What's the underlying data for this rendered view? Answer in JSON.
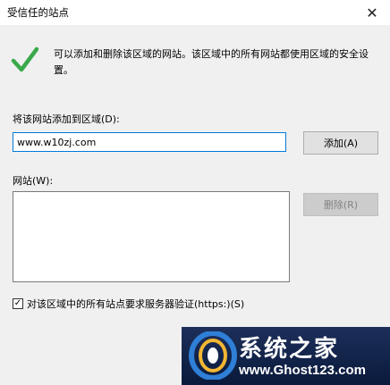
{
  "window": {
    "title": "受信任的站点",
    "close_glyph": "✕"
  },
  "info": {
    "description": "可以添加和删除该区域的网站。该区域中的所有网站都使用区域的安全设置。",
    "icon": "check-icon"
  },
  "add_section": {
    "label": "将该网站添加到区域(D):",
    "input_value": "www.w10zj.com",
    "add_button": "添加(A)"
  },
  "sites_section": {
    "label": "网站(W):",
    "items": [],
    "remove_button": "删除(R)"
  },
  "https_option": {
    "checked": true,
    "label": "对该区域中的所有站点要求服务器验证(https:)(S)"
  },
  "watermark": {
    "name": "系统之家",
    "url": "www.Ghost123.com"
  },
  "colors": {
    "check_green": "#3aa84b",
    "input_focus": "#0078d7",
    "watermark_bg": "#0a1a3c"
  }
}
